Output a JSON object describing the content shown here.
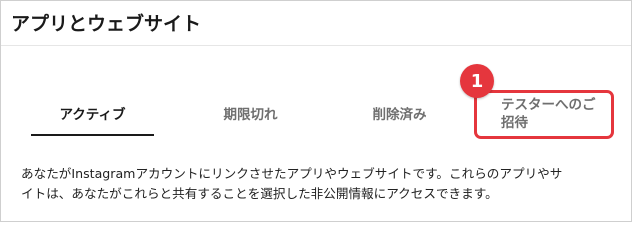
{
  "header": {
    "title": "アプリとウェブサイト"
  },
  "tabs": [
    {
      "label": "アクティブ",
      "active": true
    },
    {
      "label": "期限切れ",
      "active": false
    },
    {
      "label": "削除済み",
      "active": false
    }
  ],
  "invite_tab": {
    "line1": "テスターへのご",
    "line2": "招待"
  },
  "annotation": {
    "step_number": "1",
    "color": "#e5363d"
  },
  "description": {
    "line1": "あなたがInstagramアカウントにリンクさせたアプリやウェブサイトです。これらのアプリやサ",
    "line2": "イトは、あなたがこれらと共有することを選択した非公開情報にアクセスできます。"
  }
}
